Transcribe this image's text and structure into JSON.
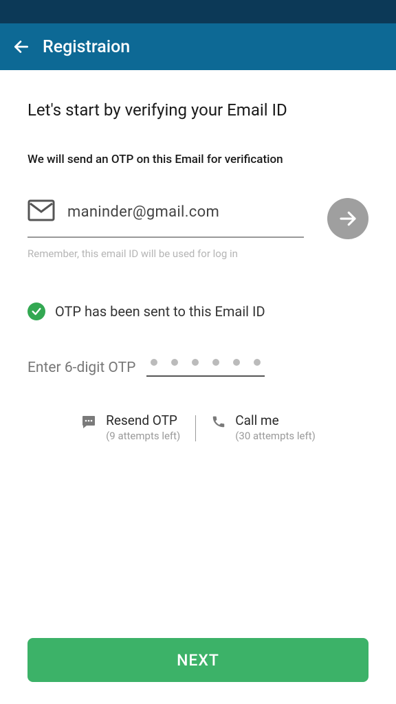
{
  "header": {
    "title": "Registraion"
  },
  "main": {
    "heading": "Let's start by verifying your Email ID",
    "subheading": "We will send an OTP on this Email for verification",
    "email_value": "maninder@gmail.com",
    "hint": "Remember, this email ID will be used for log in",
    "status_text": "OTP has been sent to this Email ID",
    "otp_label": "Enter 6-digit OTP"
  },
  "actions": {
    "resend": {
      "title": "Resend OTP",
      "sub": "(9 attempts left)"
    },
    "call": {
      "title": "Call me",
      "sub": "(30 attempts left)"
    }
  },
  "footer": {
    "next_label": "NEXT"
  }
}
